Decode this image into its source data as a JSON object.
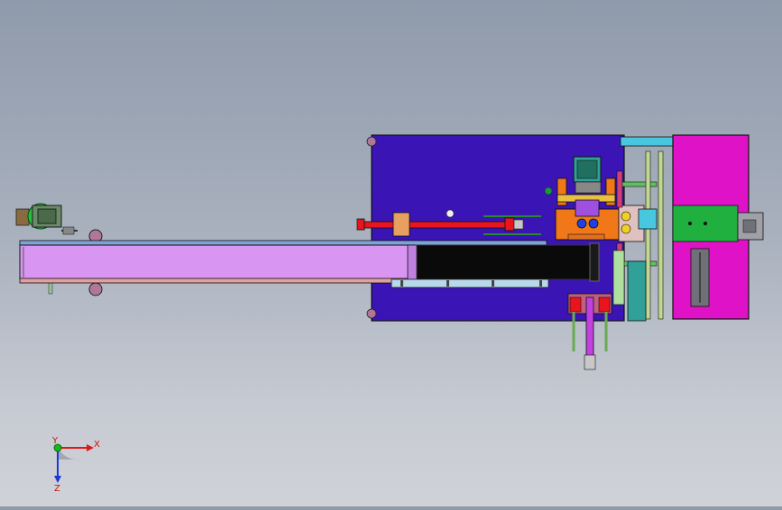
{
  "viewport": {
    "background_top": "#8f9aab",
    "background_bottom": "#d0d2d8"
  },
  "colors": {
    "main_plate": "#3a14b4",
    "conveyor_belt": "#d896f2",
    "cylinder_red": "#e8141e",
    "orange_block": "#f07818",
    "magenta_panel": "#e012c8",
    "cyan_accent": "#48c8e0",
    "teal_block": "#30a098",
    "green_gear": "#22c040",
    "belt_black": "#0a0a0a",
    "light_blue": "#b8d8ec"
  },
  "triad": {
    "x_label": "X",
    "y_label": "Y",
    "z_label": "Z",
    "x_color": "#e01818",
    "y_color": "#18b818",
    "z_color": "#1838d8"
  }
}
